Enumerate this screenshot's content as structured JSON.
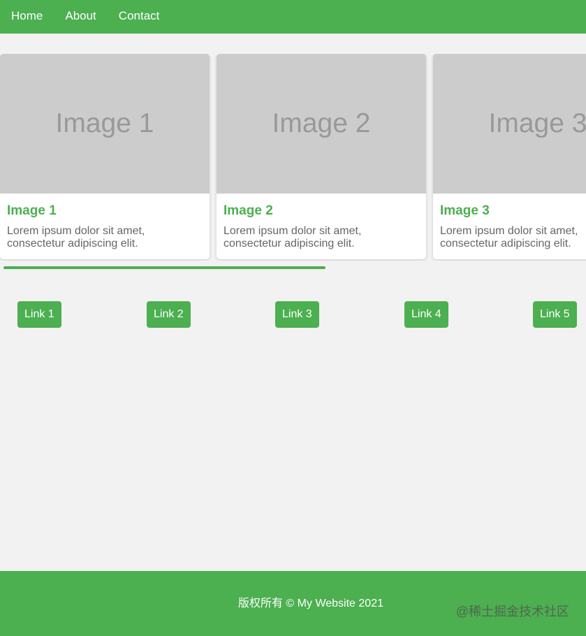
{
  "nav": {
    "items": [
      {
        "label": "Home"
      },
      {
        "label": "About"
      },
      {
        "label": "Contact"
      }
    ]
  },
  "carousel": {
    "cards": [
      {
        "image_label": "Image 1",
        "title": "Image 1",
        "text": "Lorem ipsum dolor sit amet, consectetur adipiscing elit."
      },
      {
        "image_label": "Image 2",
        "title": "Image 2",
        "text": "Lorem ipsum dolor sit amet, consectetur adipiscing elit."
      },
      {
        "image_label": "Image 3",
        "title": "Image 3",
        "text": "Lorem ipsum dolor sit amet, consectetur adipiscing elit."
      }
    ]
  },
  "links": [
    {
      "label": "Link 1"
    },
    {
      "label": "Link 2"
    },
    {
      "label": "Link 3"
    },
    {
      "label": "Link 4"
    },
    {
      "label": "Link 5"
    }
  ],
  "footer": {
    "copyright": "版权所有 © My Website 2021",
    "watermark": "@稀土掘金技术社区"
  },
  "colors": {
    "accent": "#4caf50",
    "background": "#f2f2f2",
    "image_placeholder": "#cccccc"
  }
}
